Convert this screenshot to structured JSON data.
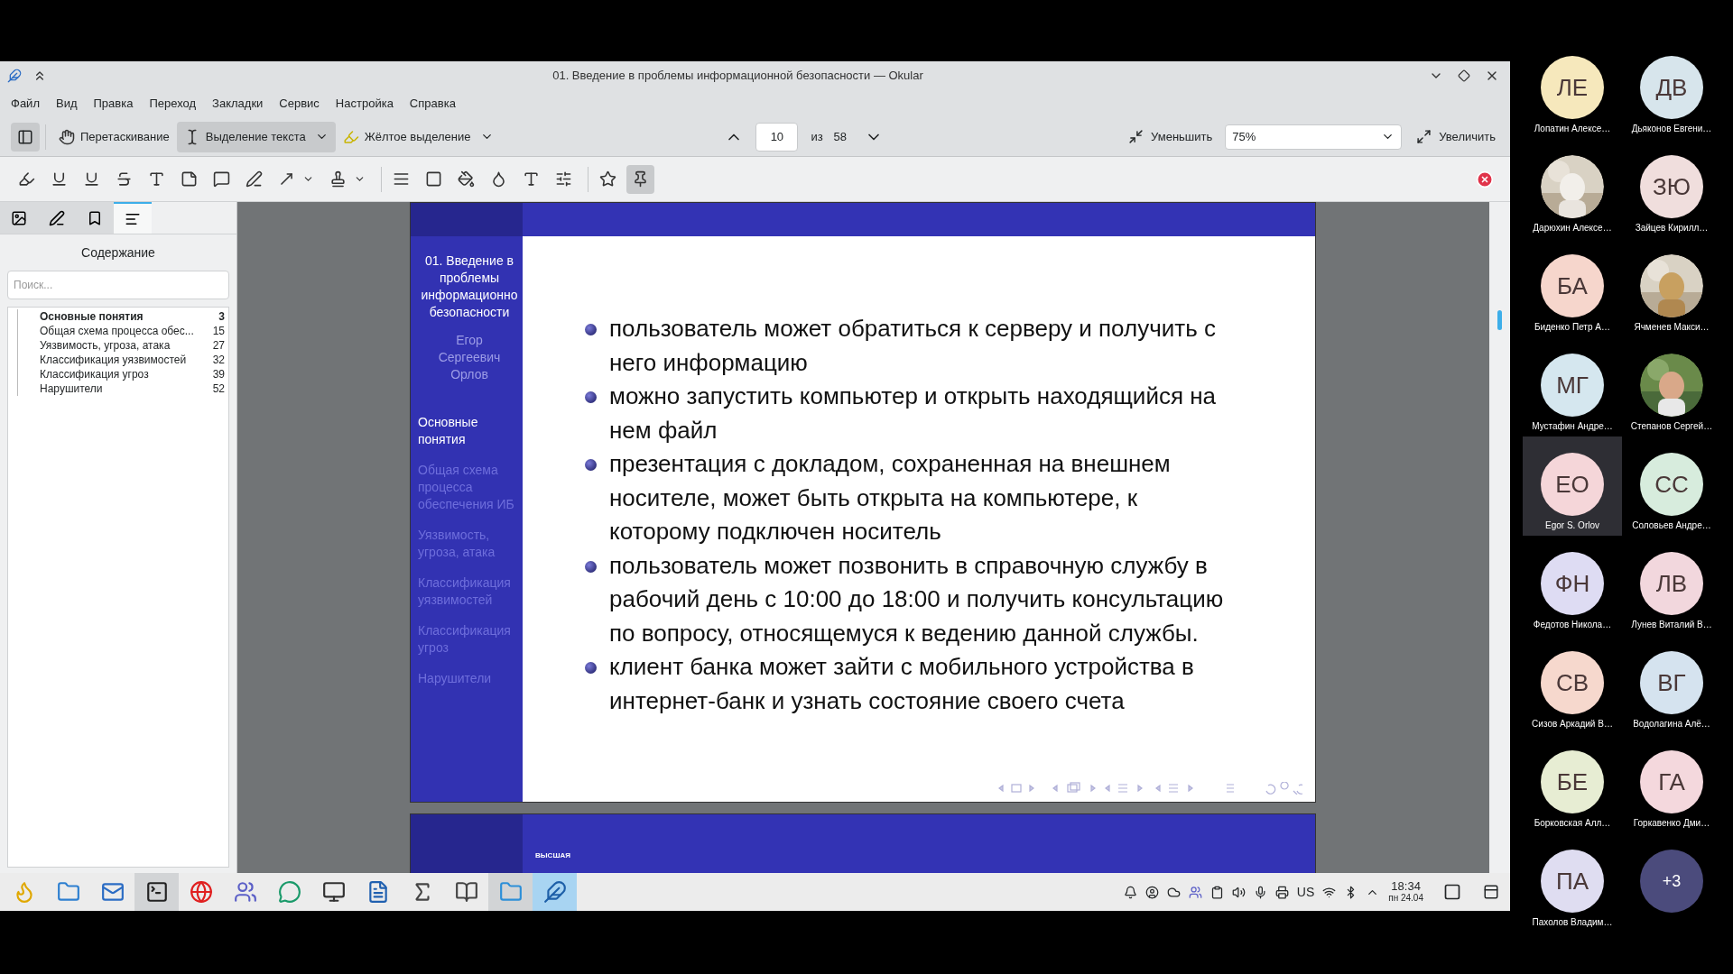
{
  "window": {
    "title": "01. Введение в проблемы информационной безопасности — Okular"
  },
  "menu": [
    "Файл",
    "Вид",
    "Правка",
    "Переход",
    "Закладки",
    "Сервис",
    "Настройка",
    "Справка"
  ],
  "toolbar": {
    "sidebar_toggle": {
      "on": true
    },
    "tools": [
      {
        "kind": "hand",
        "label": "Перетаскивание",
        "selected": false,
        "dropdown": false
      },
      {
        "kind": "text-select",
        "label": "Выделение текста",
        "selected": true,
        "dropdown": true
      },
      {
        "kind": "highlight",
        "label": "Жёлтое выделение",
        "selected": false,
        "dropdown": true
      }
    ],
    "page": "10",
    "page_of": "из",
    "page_count": "58",
    "zoom_out": "Уменьшить",
    "zoom": "75%",
    "zoom_in": "Увеличить"
  },
  "annotation_tools": [
    {
      "kind": "highlighter",
      "selected": false,
      "dropdown": false
    },
    {
      "kind": "underline",
      "selected": false,
      "dropdown": false
    },
    {
      "kind": "squiggle",
      "selected": false,
      "dropdown": false
    },
    {
      "kind": "strikeout",
      "selected": false,
      "dropdown": false
    },
    {
      "kind": "typewriter",
      "selected": false,
      "dropdown": false
    },
    {
      "kind": "note",
      "selected": false,
      "dropdown": false
    },
    {
      "kind": "comment",
      "selected": false,
      "dropdown": false
    },
    {
      "kind": "freehand",
      "selected": false,
      "dropdown": false
    },
    {
      "kind": "arrow",
      "selected": false,
      "dropdown": true
    },
    {
      "kind": "stamp",
      "selected": false,
      "dropdown": true
    },
    {
      "kind": "lines",
      "selected": false,
      "dropdown": false
    },
    {
      "kind": "shape",
      "selected": false,
      "dropdown": false
    },
    {
      "kind": "fill",
      "selected": false,
      "dropdown": false
    },
    {
      "kind": "opacity",
      "selected": false,
      "dropdown": false
    },
    {
      "kind": "font",
      "selected": false,
      "dropdown": false
    },
    {
      "kind": "settings",
      "selected": false,
      "dropdown": false
    },
    {
      "kind": "favorite",
      "selected": false,
      "dropdown": false
    },
    {
      "kind": "pin",
      "selected": true,
      "dropdown": false
    }
  ],
  "sidebar": {
    "tabs": [
      {
        "kind": "thumbnails",
        "selected": false
      },
      {
        "kind": "annotations",
        "selected": false
      },
      {
        "kind": "bookmarks",
        "selected": false
      },
      {
        "kind": "contents",
        "selected": true
      }
    ],
    "title": "Содержание",
    "search": {
      "placeholder": "Поиск..."
    },
    "toc": [
      {
        "title": "Основные понятия",
        "page": "3",
        "selected": true
      },
      {
        "title": "Общая схема процесса обес...",
        "page": "15",
        "selected": false
      },
      {
        "title": "Уязвимость, угроза, атака",
        "page": "27",
        "selected": false
      },
      {
        "title": "Классификация уязвимостей",
        "page": "32",
        "selected": false
      },
      {
        "title": "Классификация угроз",
        "page": "39",
        "selected": false
      },
      {
        "title": "Нарушители",
        "page": "52",
        "selected": false
      }
    ]
  },
  "slide": {
    "title": "01. Введение в проблемы информационно безопасности",
    "author": "Егор Сергеевич Орлов",
    "sections": [
      {
        "title": "Основные понятия",
        "selected": true
      },
      {
        "title": "Общая схема процесса обеспечения ИБ",
        "selected": false
      },
      {
        "title": "Уязвимость, угроза, атака",
        "selected": false
      },
      {
        "title": "Классификация уязвимостей",
        "selected": false
      },
      {
        "title": "Классификация угроз",
        "selected": false
      },
      {
        "title": "Нарушители",
        "selected": false
      }
    ],
    "bullets": [
      "пользователь может обратиться к серверу и получить с него информацию",
      "можно запустить компьютер и открыть находящийся на нем файл",
      "презентация с докладом, сохраненная на внешнем носителе, может быть открыта на компьютере, к которому подключен носитель",
      "пользователь может позвонить в справочную службу в рабочий день с 10:00 до 18:00 и получить консультацию по вопросу, относящемуся к ведению данной службы.",
      "клиент банка может зайти с мобильного устройства в интернет-банк и узнать состояние своего счета"
    ]
  },
  "next_slide": {
    "logo_text": "ВЫСШАЯ"
  },
  "taskbar": {
    "apps": [
      {
        "kind": "logo",
        "selected": false,
        "running": false
      },
      {
        "kind": "files",
        "selected": false,
        "running": false
      },
      {
        "kind": "mail",
        "selected": false,
        "running": false
      },
      {
        "kind": "terminal",
        "selected": false,
        "running": true
      },
      {
        "kind": "browser",
        "selected": false,
        "running": false
      },
      {
        "kind": "teams",
        "selected": false,
        "running": false
      },
      {
        "kind": "chat",
        "selected": false,
        "running": false
      },
      {
        "kind": "screenshot",
        "selected": false,
        "running": false
      },
      {
        "kind": "writer",
        "selected": false,
        "running": false
      },
      {
        "kind": "math",
        "selected": false,
        "running": false
      },
      {
        "kind": "pdf",
        "selected": false,
        "running": false
      },
      {
        "kind": "folder",
        "selected": false,
        "running": true
      },
      {
        "kind": "okular",
        "selected": true,
        "running": true
      }
    ],
    "keyboard_layout": "US",
    "time": "18:34",
    "date": "пн 24.04"
  },
  "participant_rows": [
    {
      "participants": [
        {
          "kind": "initials",
          "initials": "ЛЕ",
          "name": "Лопатин Алексе…",
          "color": "#f6e8bc",
          "selected": false
        },
        {
          "kind": "initials",
          "initials": "ДВ",
          "name": "Дьяконов Евгени…",
          "color": "#d7e5ec",
          "selected": false
        }
      ]
    },
    {
      "participants": [
        {
          "kind": "picture",
          "name": "Дарюхин Алексе…",
          "selected": false
        },
        {
          "kind": "initials",
          "initials": "ЗЮ",
          "name": "Зайцев Кирилл…",
          "color": "#f0dedd",
          "selected": false
        }
      ]
    },
    {
      "participants": [
        {
          "kind": "initials",
          "initials": "БА",
          "name": "Биденко Петр А…",
          "color": "#f6d6cc",
          "selected": false
        },
        {
          "kind": "picture",
          "name": "Ячменев Макси…",
          "selected": false
        }
      ]
    },
    {
      "participants": [
        {
          "kind": "initials",
          "initials": "МГ",
          "name": "Мустафин Андре…",
          "color": "#d5e7ef",
          "selected": false
        },
        {
          "kind": "picture",
          "name": "Степанов Сергей…",
          "selected": false
        }
      ]
    },
    {
      "participants": [
        {
          "kind": "initials",
          "initials": "ЕО",
          "name": "Egor S. Orlov",
          "color": "#f5d6d9",
          "selected": true
        },
        {
          "kind": "initials",
          "initials": "СС",
          "name": "Соловьев Андре…",
          "color": "#d7ecdd",
          "selected": false
        }
      ]
    },
    {
      "participants": [
        {
          "kind": "initials",
          "initials": "ФН",
          "name": "Федотов Никола…",
          "color": "#dedcf3",
          "selected": false
        },
        {
          "kind": "initials",
          "initials": "ЛВ",
          "name": "Лунев Виталий В…",
          "color": "#f2d7dd",
          "selected": false
        }
      ]
    },
    {
      "participants": [
        {
          "kind": "initials",
          "initials": "СВ",
          "name": "Сизов Аркадий В…",
          "color": "#f6d8cd",
          "selected": false
        },
        {
          "kind": "initials",
          "initials": "ВГ",
          "name": "Водолагина Алё…",
          "color": "#d5e3ef",
          "selected": false
        }
      ]
    },
    {
      "participants": [
        {
          "kind": "initials",
          "initials": "БЕ",
          "name": "Борковская Алл…",
          "color": "#e7edd3",
          "selected": false
        },
        {
          "kind": "initials",
          "initials": "ГА",
          "name": "Горкавенко Дми…",
          "color": "#f4d8dd",
          "selected": false
        }
      ]
    },
    {
      "participants": [
        {
          "kind": "initials",
          "initials": "ПА",
          "name": "Пахолов Владим…",
          "color": "#dfddf1",
          "selected": false
        },
        {
          "kind": "more",
          "initials": "+3",
          "color": "#4b4b7c",
          "selected": false
        }
      ]
    }
  ]
}
